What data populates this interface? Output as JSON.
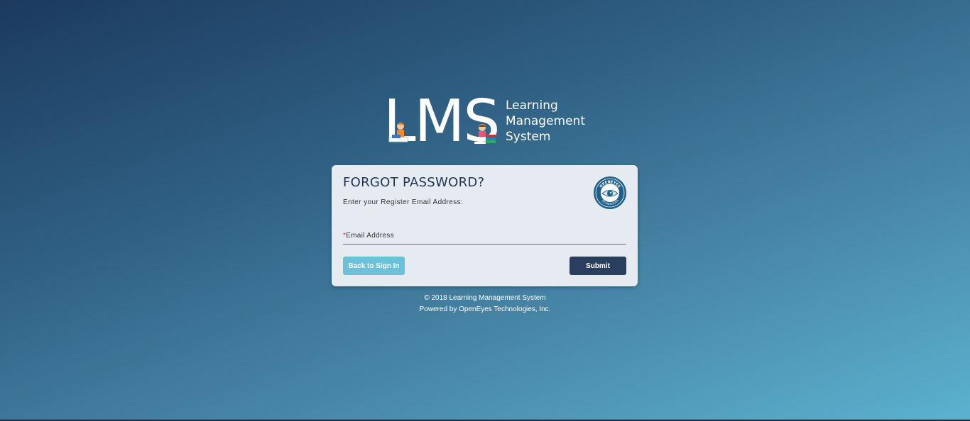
{
  "logo": {
    "letters": "LMS",
    "tagline": [
      "Learning",
      "Management",
      "System"
    ]
  },
  "card": {
    "title": "FORGOT PASSWORD?",
    "subtitle": "Enter your Register Email Address:",
    "badge_icon": "openeyes-technologies-logo",
    "badge_text_top": "OPENEYES",
    "badge_text_bottom": "TECHNOLOGIES",
    "email": {
      "required_mark": "*",
      "label": "Email Address",
      "value": ""
    },
    "back_label": "Back to Sign In",
    "submit_label": "Submit"
  },
  "footer": {
    "copyright": "© 2018 Learning Management System",
    "powered_by": "Powered by OpenEyes Technologies, Inc."
  },
  "colors": {
    "accent_light": "#6cc1da",
    "accent_dark": "#2a3f60",
    "card_bg": "#e5ebf1"
  }
}
